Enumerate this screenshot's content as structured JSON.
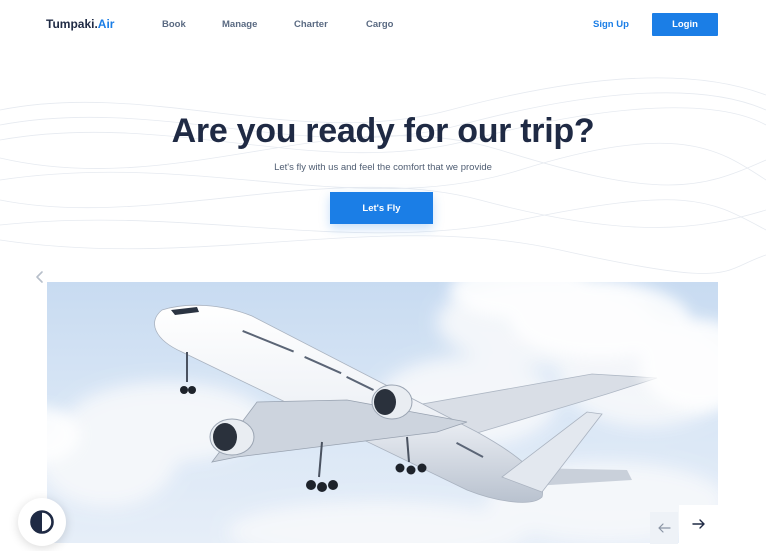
{
  "header": {
    "logo_main": "Tumpaki.",
    "logo_accent": "Air",
    "nav": [
      "Book",
      "Manage",
      "Charter",
      "Cargo"
    ],
    "signup_label": "Sign Up",
    "login_label": "Login"
  },
  "hero": {
    "title": "Are you ready for our trip?",
    "subtitle": "Let's fly with us and feel the comfort that we provide",
    "cta_label": "Let's Fly"
  },
  "icons": {
    "prev_slide": "chevron-left-icon",
    "arrow_prev": "arrow-left-icon",
    "arrow_next": "arrow-right-icon",
    "theme": "contrast-half-circle-icon"
  },
  "colors": {
    "accent": "#1b7ee6",
    "heading": "#1f2a44",
    "sky": "#d3e3f4"
  }
}
